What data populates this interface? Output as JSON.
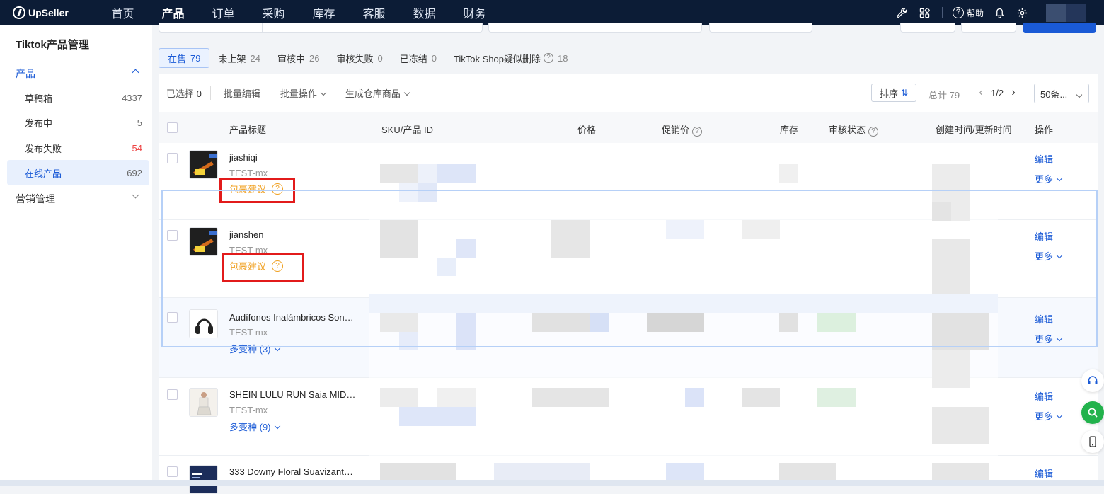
{
  "app": {
    "logo_text": "UpSeller",
    "nav": [
      "首页",
      "产品",
      "订单",
      "采购",
      "库存",
      "客服",
      "数据",
      "财务"
    ],
    "nav_active_index": 1,
    "help_label": "帮助"
  },
  "sidebar": {
    "title": "Tiktok产品管理",
    "group_product": "产品",
    "items": [
      {
        "label": "草稿箱",
        "count": "4337"
      },
      {
        "label": "发布中",
        "count": "5"
      },
      {
        "label": "发布失败",
        "count": "54"
      },
      {
        "label": "在线产品",
        "count": "692"
      }
    ],
    "group_marketing": "营销管理"
  },
  "tabs": [
    {
      "label": "在售",
      "count": "79"
    },
    {
      "label": "未上架",
      "count": "24"
    },
    {
      "label": "审核中",
      "count": "26"
    },
    {
      "label": "审核失败",
      "count": "0"
    },
    {
      "label": "已冻结",
      "count": "0"
    },
    {
      "label": "TikTok Shop疑似删除",
      "count": "18"
    }
  ],
  "toolbar": {
    "selected_label": "已选择",
    "selected_count": "0",
    "bulk_edit": "批量编辑",
    "bulk_ops": "批量操作",
    "gen_warehouse": "生成仓库商品",
    "sort": "排序",
    "total": "总计 79",
    "page": "1/2",
    "per_page": "50条..."
  },
  "table": {
    "headers": {
      "title": "产品标题",
      "sku": "SKU/产品 ID",
      "price": "价格",
      "promo": "促销价",
      "stock": "库存",
      "review": "审核状态",
      "time": "创建时间/更新时间",
      "ops": "操作"
    },
    "rows": [
      {
        "title": "jiashiqi",
        "store": "TEST-mx",
        "extra": "包裹建议",
        "edit": "编辑",
        "more": "更多"
      },
      {
        "title": "jianshen",
        "store": "TEST-mx",
        "extra": "包裹建议",
        "edit": "编辑",
        "more": "更多"
      },
      {
        "title": "Audífonos Inalámbricos Son…",
        "store": "TEST-mx",
        "extra": "多变种 (3)",
        "edit": "编辑",
        "more": "更多"
      },
      {
        "title": "SHEIN LULU RUN Saia MID…",
        "store": "TEST-mx",
        "extra": "多变种 (9)",
        "edit": "编辑",
        "more": "更多"
      },
      {
        "title": "333 Downy Floral Suavizant…",
        "store": "",
        "extra": "",
        "edit": "编辑",
        "more": ""
      }
    ]
  },
  "colors": {
    "nav_bg": "#0c1c36",
    "accent": "#1a5ad6",
    "warning": "#f0a020",
    "annotation": "#e21b1b"
  }
}
